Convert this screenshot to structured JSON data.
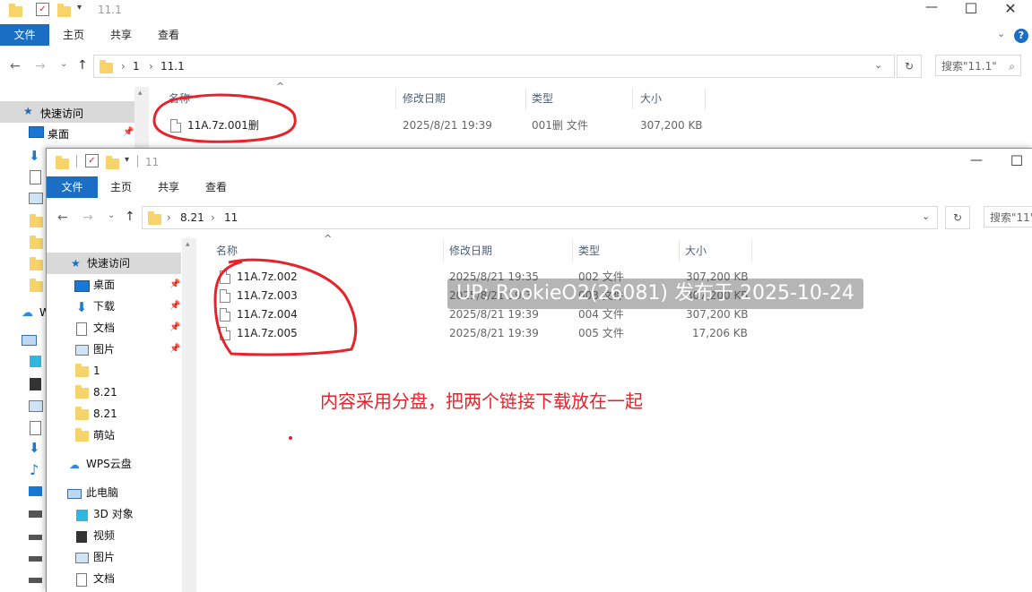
{
  "back_window": {
    "title": "11.1",
    "ribbon_tabs": [
      "文件",
      "主页",
      "共享",
      "查看"
    ],
    "breadcrumb": [
      "1",
      "11.1"
    ],
    "search_placeholder": "搜索\"11.1\"",
    "quick_access_label": "快速访问",
    "sidebar_items": [
      "桌面",
      "W"
    ],
    "columns": {
      "name": "名称",
      "date": "修改日期",
      "type": "类型",
      "size": "大小"
    },
    "files": [
      {
        "name": "11A.7z.001删",
        "date": "2025/8/21 19:39",
        "type": "001删 文件",
        "size": "307,200 KB"
      }
    ]
  },
  "front_window": {
    "title": "11",
    "ribbon_tabs": [
      "文件",
      "主页",
      "共享",
      "查看"
    ],
    "breadcrumb": [
      "8.21",
      "11"
    ],
    "search_placeholder": "搜索\"11\"",
    "sidebar": {
      "quick_access": "快速访问",
      "items": [
        {
          "label": "桌面",
          "icon": "desktop-icon"
        },
        {
          "label": "下载",
          "icon": "download-icon"
        },
        {
          "label": "文档",
          "icon": "document-icon"
        },
        {
          "label": "图片",
          "icon": "picture-icon"
        },
        {
          "label": "1",
          "icon": "folder-icon"
        },
        {
          "label": "8.21",
          "icon": "folder-icon"
        },
        {
          "label": "8.21",
          "icon": "folder-icon"
        },
        {
          "label": "萌站",
          "icon": "folder-icon"
        }
      ],
      "wps": "WPS云盘",
      "this_pc": "此电脑",
      "pc_items": [
        {
          "label": "3D 对象",
          "icon": "cube-icon"
        },
        {
          "label": "视频",
          "icon": "video-icon"
        },
        {
          "label": "图片",
          "icon": "picture-icon"
        },
        {
          "label": "文档",
          "icon": "document-icon"
        }
      ]
    },
    "columns": {
      "name": "名称",
      "date": "修改日期",
      "type": "类型",
      "size": "大小"
    },
    "files": [
      {
        "name": "11A.7z.002",
        "date": "2025/8/21 19:35",
        "type": "002 文件",
        "size": "307,200 KB"
      },
      {
        "name": "11A.7z.003",
        "date": "2025/8/21 19:3",
        "type": "003 文件",
        "size": "307,200 KB"
      },
      {
        "name": "11A.7z.004",
        "date": "2025/8/21 19:39",
        "type": "004 文件",
        "size": "307,200 KB"
      },
      {
        "name": "11A.7z.005",
        "date": "2025/8/21 19:39",
        "type": "005 文件",
        "size": "17,206 KB"
      }
    ]
  },
  "watermark": "UP: RookieO2(26081) 发布于 2025-10-24",
  "annotation_note": "内容采用分盘，把两个链接下载放在一起",
  "colors": {
    "accent": "#1a6fc4",
    "annotation": "#e8222a"
  }
}
